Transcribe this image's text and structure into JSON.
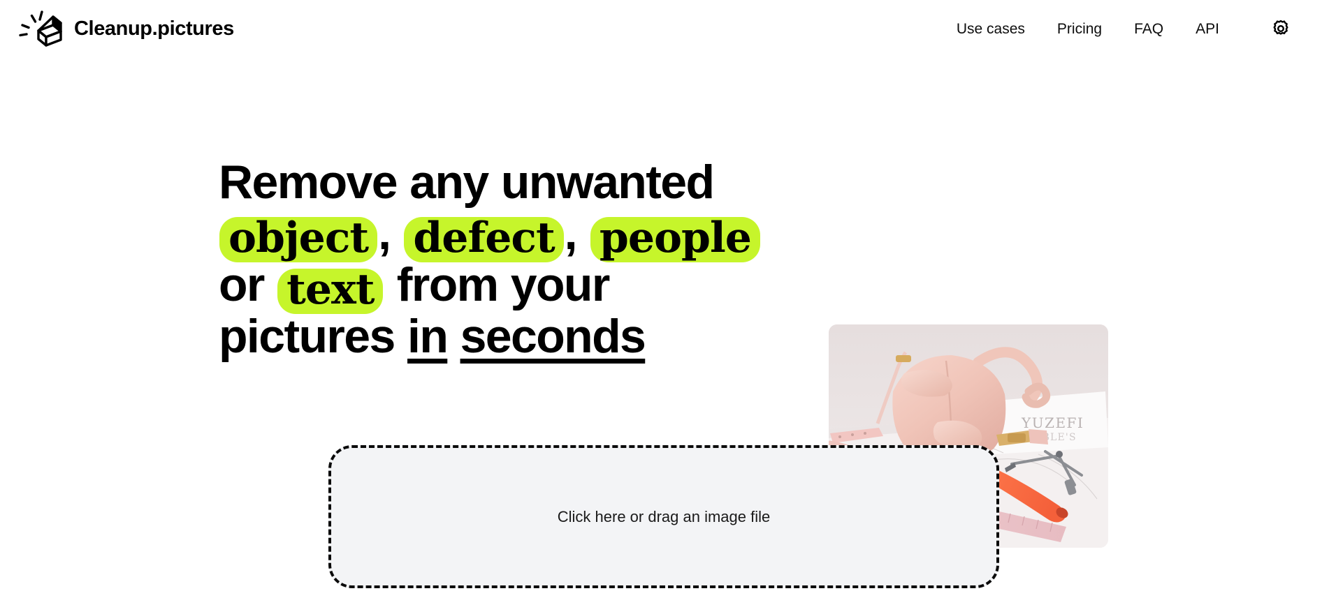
{
  "header": {
    "brand": {
      "name": "Cleanup.pictures",
      "logo_icon": "eraser-sparkle-icon"
    },
    "nav": [
      {
        "label": "Use cases"
      },
      {
        "label": "Pricing"
      },
      {
        "label": "FAQ"
      },
      {
        "label": "API"
      }
    ],
    "settings": {
      "icon": "gear-icon",
      "label": "Settings"
    }
  },
  "hero": {
    "headline": {
      "line1": "Remove any unwanted",
      "highlight_1": "object",
      "sep_1": ",",
      "highlight_2": "defect",
      "sep_2": ",",
      "highlight_3": "people",
      "mid_1": "or",
      "highlight_4": "text",
      "mid_2": "from your pictures",
      "underlined_1": "in",
      "underlined_2": "seconds"
    },
    "photo": {
      "alt": "Pink bunny-shaped leather handbag on a desk with ruler, pen, compass and paper",
      "paper_text_1": "YUZEFI",
      "paper_text_2": "PEBBLE'S"
    }
  },
  "dropzone": {
    "label": "Click here or drag an image file"
  },
  "colors": {
    "highlight": "#c6f52b",
    "dropzone_bg": "#f3f4f6",
    "dropzone_border": "#0b0b0b",
    "text": "#000000"
  }
}
